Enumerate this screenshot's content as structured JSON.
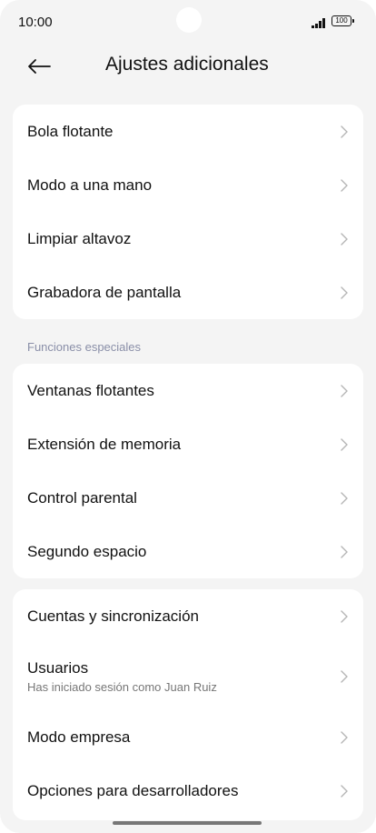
{
  "status": {
    "time": "10:00",
    "battery": "100"
  },
  "header": {
    "title": "Ajustes adicionales"
  },
  "group1": {
    "items": [
      {
        "label": "Bola flotante"
      },
      {
        "label": "Modo a una mano"
      },
      {
        "label": "Limpiar altavoz"
      },
      {
        "label": "Grabadora de pantalla"
      }
    ]
  },
  "section_special": {
    "label": "Funciones especiales"
  },
  "group2": {
    "items": [
      {
        "label": "Ventanas flotantes"
      },
      {
        "label": "Extensión de memoria"
      },
      {
        "label": "Control parental"
      },
      {
        "label": "Segundo espacio"
      }
    ]
  },
  "group3": {
    "items": [
      {
        "label": "Cuentas y sincronización"
      },
      {
        "label": "Usuarios",
        "sublabel": "Has iniciado sesión como Juan Ruiz"
      },
      {
        "label": "Modo empresa"
      },
      {
        "label": "Opciones para desarrolladores"
      }
    ]
  }
}
